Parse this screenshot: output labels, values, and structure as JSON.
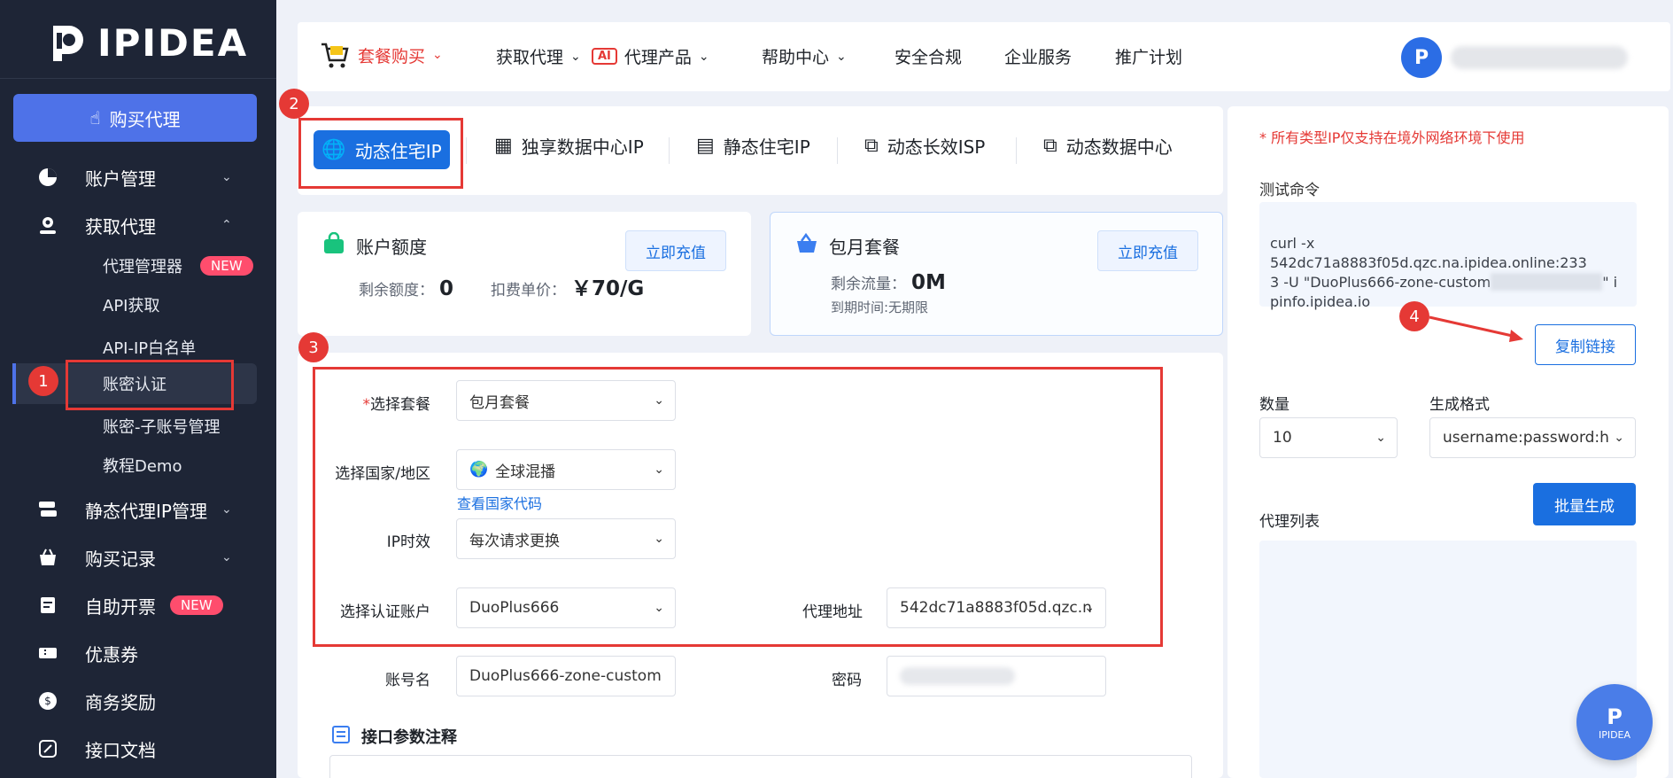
{
  "sidebar": {
    "logo_text": "IPIDEA",
    "buy_label": "购买代理",
    "items": [
      {
        "label": "账户管理"
      },
      {
        "label": "获取代理"
      },
      {
        "label": "静态代理IP管理"
      },
      {
        "label": "购买记录"
      },
      {
        "label": "自助开票",
        "badge": "NEW"
      },
      {
        "label": "优惠券"
      },
      {
        "label": "商务奖励"
      },
      {
        "label": "接口文档"
      }
    ],
    "sub_items": [
      {
        "label": "代理管理器",
        "badge": "NEW"
      },
      {
        "label": "API获取"
      },
      {
        "label": "API-IP白名单"
      },
      {
        "label": "账密认证"
      },
      {
        "label": "账密-子账号管理"
      },
      {
        "label": "教程Demo"
      }
    ]
  },
  "steps": [
    "1",
    "2",
    "3",
    "4"
  ],
  "topnav": {
    "cart_label": "套餐购买",
    "items": [
      "获取代理",
      "代理产品",
      "帮助中心",
      "安全合规",
      "企业服务",
      "推广计划"
    ],
    "ai_badge": "AI"
  },
  "tabs": [
    "动态住宅IP",
    "独享数据中心IP",
    "静态住宅IP",
    "动态长效ISP",
    "动态数据中心"
  ],
  "account_card": {
    "title": "账户额度",
    "charge_label": "立即充值",
    "balance_label": "剩余额度：",
    "balance_value": "0",
    "price_label": "扣费单价：",
    "price_value": "￥70/G"
  },
  "monthly_card": {
    "title": "包月套餐",
    "charge_label": "立即充值",
    "traffic_label": "剩余流量：",
    "traffic_value": "0M",
    "expire_text": "到期时间:无期限"
  },
  "form": {
    "required_mark": "*",
    "package_label": "选择套餐",
    "package_value": "包月套餐",
    "country_label": "选择国家/地区",
    "country_value": "全球混播",
    "country_code_link": "查看国家代码",
    "ip_label": "IP时效",
    "ip_value": "每次请求更换",
    "account_label": "选择认证账户",
    "account_value": "DuoPlus666",
    "proxy_addr_label": "代理地址",
    "proxy_addr_value": "542dc71a8883f05d.qzc.n",
    "username_label": "账号名",
    "username_value": "DuoPlus666-zone-custom",
    "password_label": "密码",
    "params_title": "接口参数注释"
  },
  "right_panel": {
    "notice": "* 所有类型IP仅支持在境外网络环境下使用",
    "test_cmd_label": "测试命令",
    "test_cmd_line1": "curl -x 542dc71a8883f05d.qzc.na.ipidea.online:233",
    "test_cmd_line2a": "3 -U \"DuoPlus666-zone-custom",
    "test_cmd_line2b": "\" i",
    "test_cmd_line3": "pinfo.ipidea.io",
    "copy_label": "复制链接",
    "qty_label": "数量",
    "qty_value": "10",
    "format_label": "生成格式",
    "format_value": "username:password:h",
    "generate_label": "批量生成",
    "proxy_list_label": "代理列表"
  },
  "float_logo_text": "IPIDEA",
  "colors": {
    "accent": "#1a6fe0",
    "sidebar": "#1e2536",
    "highlight": "#e53935"
  }
}
